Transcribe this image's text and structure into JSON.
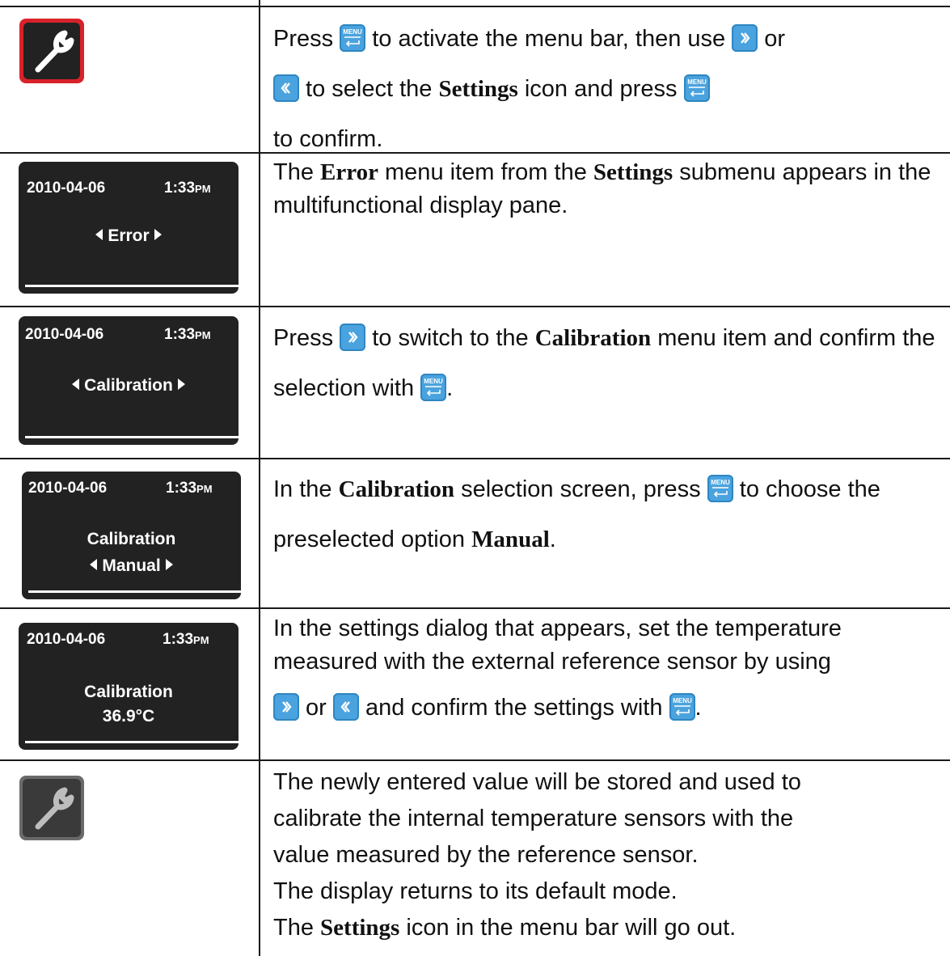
{
  "rows": [
    {
      "icon": "wrench-icon-active",
      "text_parts": [
        "Press ",
        "MENU",
        " to activate the menu bar, then use ",
        "RIGHT",
        " or ",
        "LEFT",
        " to select the ",
        "Settings",
        " icon and press ",
        "MENU",
        " to confirm."
      ]
    },
    {
      "screen": {
        "date": "2010-04-06",
        "time": "1:33",
        "ampm": "PM",
        "line1": "Error",
        "line2": ""
      },
      "text": {
        "a": "The ",
        "b1": "Error",
        "c": " menu item from the ",
        "b2": "Settings",
        "d": " submenu appears in the multifunctional display pane."
      }
    },
    {
      "screen": {
        "date": "2010-04-06",
        "time": "1:33",
        "ampm": "PM",
        "line1": "Calibration",
        "line2": ""
      },
      "text": {
        "a": "Press ",
        "c": " to switch to the ",
        "b1": "Calibration",
        "d": " menu item and confirm the selection with ",
        "e": "."
      }
    },
    {
      "screen": {
        "date": "2010-04-06",
        "time": "1:33",
        "ampm": "PM",
        "line1": "Calibration",
        "line2": "Manual"
      },
      "text": {
        "a": "In the ",
        "b1": "Calibration",
        "c": " selection screen, press ",
        "d": " to choose the preselected option ",
        "b2": "Manual",
        "e": "."
      }
    },
    {
      "screen": {
        "date": "2010-04-06",
        "time": "1:33",
        "ampm": "PM",
        "line1": "Calibration",
        "line2": "36.9°C"
      },
      "text": {
        "a": "In the settings dialog that appears, set the temperature measured with the external reference sensor by using",
        "c": " or ",
        "d": " and confirm the settings with ",
        "e": "."
      }
    },
    {
      "icon": "wrench-icon-inactive",
      "text": {
        "l1": "The newly entered value will be stored and used to",
        "l2": "calibrate the internal temperature sensors with the",
        "l3": "value measured by the reference sensor.",
        "l4": "The display returns to its default mode.",
        "l5a": "The ",
        "l5b": "Settings",
        "l5c": " icon in the menu bar will go out."
      }
    }
  ],
  "key_labels": {
    "menu": "MENU"
  },
  "colors": {
    "key_blue": "#4aa3de",
    "active_icon_border": "#d8222a",
    "screen_bg": "#222222"
  }
}
